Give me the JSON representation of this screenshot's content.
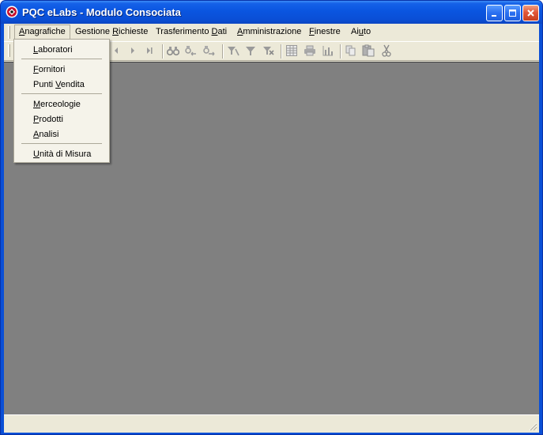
{
  "window": {
    "title": "PQC eLabs - Modulo Consociata",
    "controls": [
      "minimize-icon",
      "maximize-icon",
      "close-icon"
    ]
  },
  "menubar": {
    "items": [
      {
        "label": "Anagrafiche",
        "accel": "A",
        "active": true
      },
      {
        "label": "Gestione Richieste",
        "accel": "R"
      },
      {
        "label": "Trasferimento Dati",
        "accel": "D"
      },
      {
        "label": "Amministrazione",
        "accel": "A"
      },
      {
        "label": "Finestre",
        "accel": "F"
      },
      {
        "label": "Aiuto",
        "accel": "u"
      }
    ]
  },
  "toolbar": {
    "buttons": [
      "first-record-icon",
      "previous-record-icon",
      "next-record-icon",
      "last-record-icon",
      "find-icon",
      "find-previous-icon",
      "find-next-icon",
      "filter-by-selection-icon",
      "filter-icon",
      "remove-filter-icon",
      "table-view-icon",
      "print-icon",
      "chart-icon",
      "copy-icon",
      "paste-icon",
      "cut-icon"
    ]
  },
  "dropdown": {
    "menu": "Anagrafiche",
    "items": [
      {
        "label": "Laboratori",
        "accel": "L"
      },
      {
        "separator": true
      },
      {
        "label": "Fornitori",
        "accel": "F"
      },
      {
        "label": "Punti Vendita",
        "accel": "V"
      },
      {
        "separator": true
      },
      {
        "label": "Merceologie",
        "accel": "M"
      },
      {
        "label": "Prodotti",
        "accel": "P"
      },
      {
        "label": "Analisi",
        "accel": "A"
      },
      {
        "separator": true
      },
      {
        "label": "Unità di Misura",
        "accel": "U"
      }
    ]
  },
  "colors": {
    "titlebar": "#0a4fd6",
    "chrome": "#ece9d8",
    "mdi_background": "#808080",
    "menu_background": "#f5f3ea"
  }
}
